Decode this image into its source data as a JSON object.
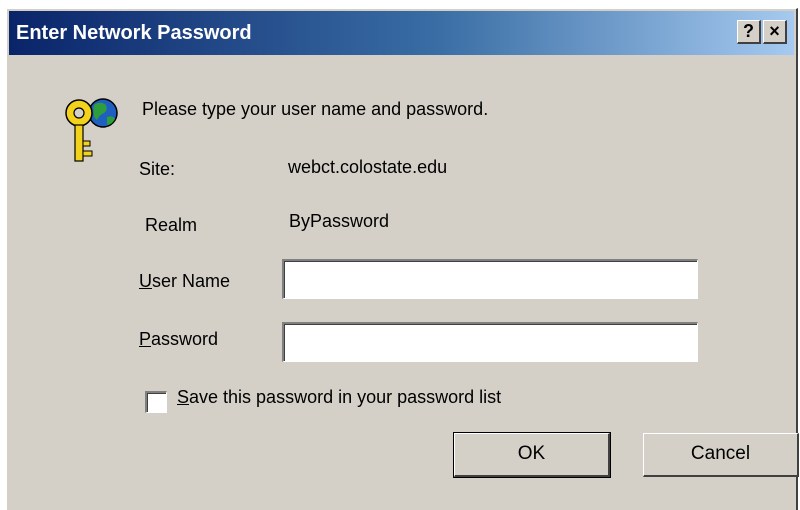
{
  "window": {
    "title": "Enter Network Password",
    "help_glyph": "?",
    "close_glyph": "×"
  },
  "icons": {
    "prompt": "key-globe-icon",
    "help": "help-icon",
    "close": "close-icon"
  },
  "prompt": "Please type your user name and password.",
  "site": {
    "label": "Site:",
    "value": "webct.colostate.edu"
  },
  "realm": {
    "label": "Realm",
    "value": "ByPassword"
  },
  "username": {
    "label_accel": "U",
    "label_rest": "ser Name",
    "value": ""
  },
  "password": {
    "label_accel": "P",
    "label_rest": "assword",
    "value": ""
  },
  "save_password": {
    "label_accel": "S",
    "label_rest": "ave this password in your password list",
    "checked": false
  },
  "buttons": {
    "ok": "OK",
    "cancel": "Cancel"
  },
  "colors": {
    "face": "#d4d0c8",
    "title_start": "#0a246a",
    "title_end": "#a6caf0"
  }
}
